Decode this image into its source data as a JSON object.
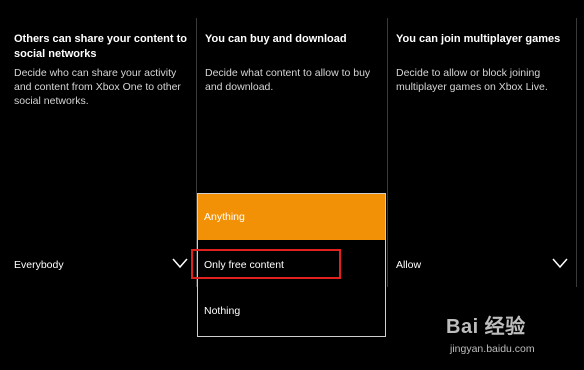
{
  "columns": [
    {
      "title": "Others can share your content to social networks",
      "description": "Decide who can share your activity and content from Xbox One to other social networks.",
      "selected": "Everybody"
    },
    {
      "title": "You can buy and download",
      "description": "Decide what content to allow to buy and download."
    },
    {
      "title": "You can join multiplayer games",
      "description": "Decide to allow or block joining multiplayer games on Xbox Live.",
      "selected": "Allow"
    }
  ],
  "dropdown": {
    "options": [
      "Anything",
      "Only free content",
      "Nothing"
    ],
    "highlighted": "Anything"
  },
  "colors": {
    "background": "#000000",
    "accent": "#f29106",
    "annotation_box": "#e0211d"
  },
  "watermark": {
    "logo_text": "Bai 经验",
    "url": "jingyan.baidu.com"
  }
}
